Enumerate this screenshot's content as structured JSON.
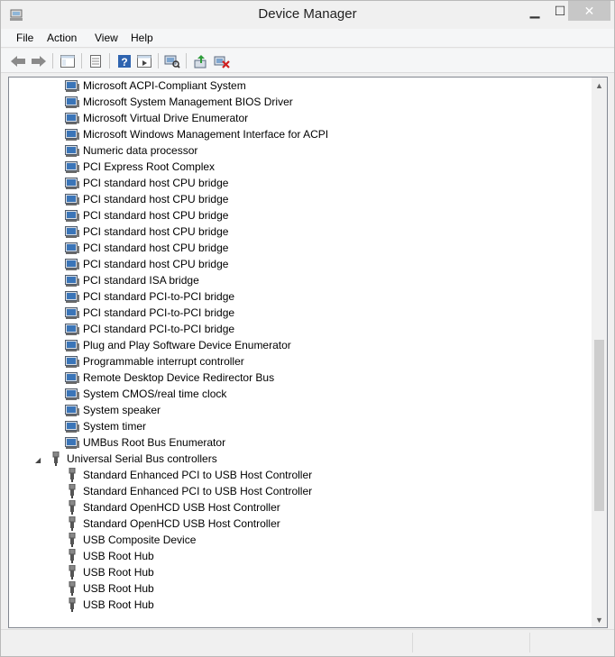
{
  "window": {
    "title": "Device Manager"
  },
  "menu": [
    "File",
    "Action",
    "View",
    "Help"
  ],
  "toolbar": {
    "buttons": [
      "back-icon",
      "forward-icon",
      "console-tree-icon",
      "properties-icon",
      "help-icon",
      "show-hide-pane-icon",
      "scan-hardware-icon",
      "update-driver-icon",
      "uninstall-device-icon"
    ]
  },
  "tree": {
    "system_devices": [
      "Microsoft ACPI-Compliant System",
      "Microsoft System Management BIOS Driver",
      "Microsoft Virtual Drive Enumerator",
      "Microsoft Windows Management Interface for ACPI",
      "Numeric data processor",
      "PCI Express Root Complex",
      "PCI standard host CPU bridge",
      "PCI standard host CPU bridge",
      "PCI standard host CPU bridge",
      "PCI standard host CPU bridge",
      "PCI standard host CPU bridge",
      "PCI standard host CPU bridge",
      "PCI standard ISA bridge",
      "PCI standard PCI-to-PCI bridge",
      "PCI standard PCI-to-PCI bridge",
      "PCI standard PCI-to-PCI bridge",
      "Plug and Play Software Device Enumerator",
      "Programmable interrupt controller",
      "Remote Desktop Device Redirector Bus",
      "System CMOS/real time clock",
      "System speaker",
      "System timer",
      "UMBus Root Bus Enumerator"
    ],
    "usb_category": {
      "label": "Universal Serial Bus controllers",
      "expander": "◢"
    },
    "usb_devices": [
      "Standard Enhanced PCI to USB Host Controller",
      "Standard Enhanced PCI to USB Host Controller",
      "Standard OpenHCD USB Host Controller",
      "Standard OpenHCD USB Host Controller",
      "USB Composite Device",
      "USB Root Hub",
      "USB Root Hub",
      "USB Root Hub",
      "USB Root Hub"
    ]
  },
  "scrollbar": {
    "position_fraction": 0.7
  },
  "colors": {
    "window_bg": "#f0f0f0",
    "tree_bg": "#ffffff",
    "close_button": "#c7c7c7"
  }
}
